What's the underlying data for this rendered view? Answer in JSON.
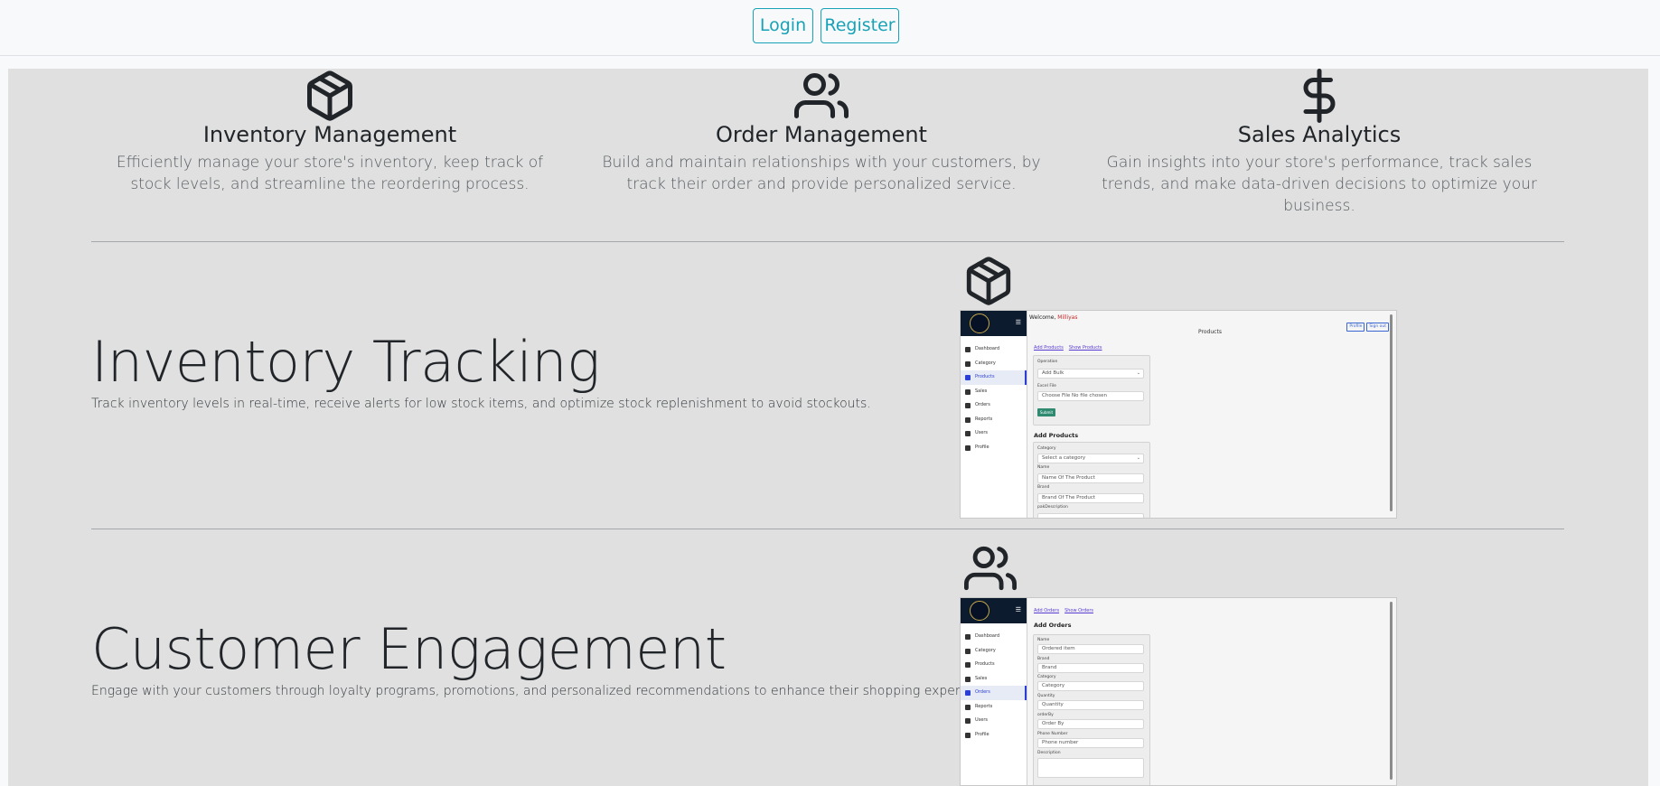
{
  "header": {
    "login_label": "Login",
    "register_label": "Register"
  },
  "features": [
    {
      "icon": "box-icon",
      "title": "Inventory Management",
      "description": "Efficiently manage your store's inventory, keep track of stock levels, and streamline the reordering process."
    },
    {
      "icon": "users-icon",
      "title": "Order Management",
      "description": "Build and maintain relationships with your customers, by track their order and provide personalized service."
    },
    {
      "icon": "dollar-icon",
      "title": "Sales Analytics",
      "description": "Gain insights into your store's performance, track sales trends, and make data-driven decisions to optimize your business."
    }
  ],
  "sections": [
    {
      "icon": "box-icon",
      "title": "Inventory Tracking",
      "description": "Track inventory levels in real-time, receive alerts for low stock items, and optimize stock replenishment to avoid stockouts.",
      "screenshot": {
        "welcome_prefix": "Welcome,",
        "welcome_name": "Milliyas",
        "top_buttons": [
          "Profile",
          "Sign out"
        ],
        "nav": [
          "Dashboard",
          "Category",
          "Products",
          "Sales",
          "Orders",
          "Reports",
          "Users",
          "Profile"
        ],
        "active_nav": "Products",
        "page_title": "Products",
        "links": [
          "Add Products",
          "Show Products"
        ],
        "operation_label": "Operation",
        "operation_value": "Add Bulk",
        "excel_label": "Excel File",
        "file_value": "Choose File  No file chosen",
        "submit_label": "Submit",
        "form_heading": "Add Products",
        "fields": [
          {
            "label": "Category",
            "value": "Select a category"
          },
          {
            "label": "Name",
            "value": "Name Of The Product"
          },
          {
            "label": "Brand",
            "value": "Brand Of The Product"
          },
          {
            "label": "pakDescription",
            "value": ""
          }
        ]
      }
    },
    {
      "icon": "users-icon",
      "title": "Customer Engagement",
      "description": "Engage with your customers through loyalty programs, promotions, and personalized recommendations to enhance their shopping experience.",
      "screenshot": {
        "nav": [
          "Dashboard",
          "Category",
          "Products",
          "Sales",
          "Orders",
          "Reports",
          "Users",
          "Profile"
        ],
        "active_nav": "Orders",
        "links": [
          "Add Orders",
          "Show Orders"
        ],
        "form_heading": "Add Orders",
        "fields": [
          {
            "label": "Name",
            "value": "Ordered item"
          },
          {
            "label": "Brand",
            "value": "Brand"
          },
          {
            "label": "Category",
            "value": "Category"
          },
          {
            "label": "Quantity",
            "value": "Quantity"
          },
          {
            "label": "orderBy",
            "value": "Order By"
          },
          {
            "label": "Phone Number",
            "value": "Phone number"
          },
          {
            "label": "Description",
            "value": ""
          }
        ]
      }
    }
  ]
}
